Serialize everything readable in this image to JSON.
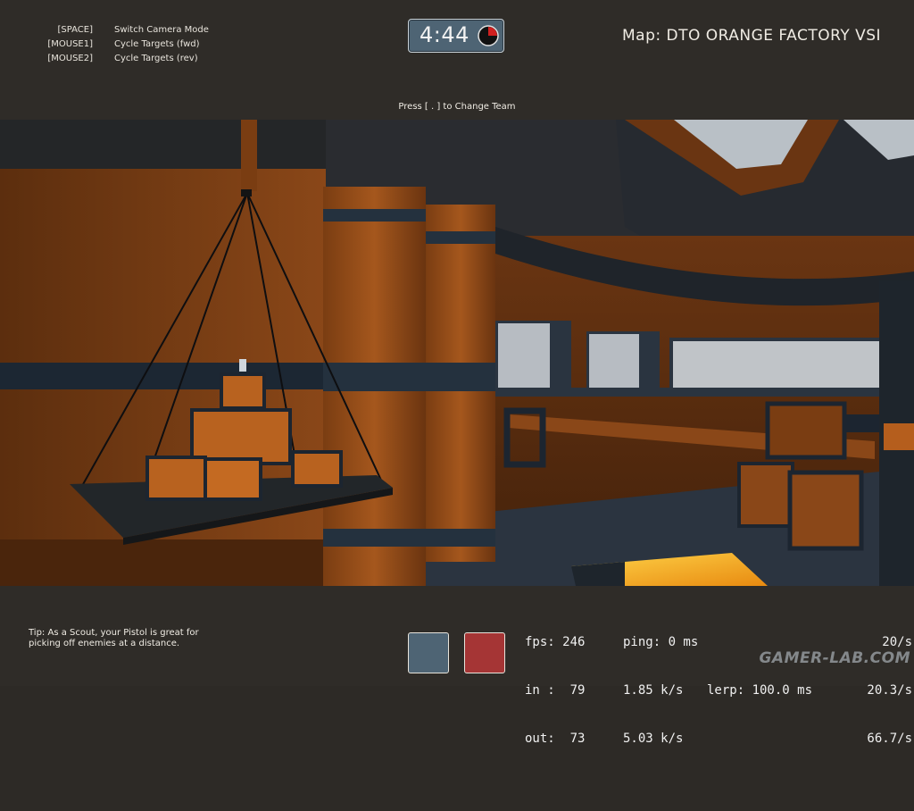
{
  "key_binds": [
    {
      "key": "[SPACE]",
      "action": "Switch Camera Mode"
    },
    {
      "key": "[MOUSE1]",
      "action": "Cycle Targets (fwd)"
    },
    {
      "key": "[MOUSE2]",
      "action": "Cycle Targets (rev)"
    }
  ],
  "round_timer": {
    "time": "4:44",
    "elapsed_fraction": 0.25
  },
  "map": {
    "label": "Map: DTO ORANGE FACTORY VSI"
  },
  "team_hint": "Press [ . ] to Change Team",
  "tip": "Tip: As a Scout, your Pistol is great for picking off enemies at a distance.",
  "team_buttons": {
    "blue_color": "#4e6474",
    "red_color": "#a53535"
  },
  "net_graph": {
    "fps": "fps: 246",
    "ping": "ping: 0 ms",
    "rate_top": "20/s",
    "in": "in :  79",
    "in_rate": "1.85 k/s",
    "lerp": "lerp: 100.0 ms",
    "rate_mid": "20.3/s",
    "out": "out:  73",
    "out_rate": "5.03 k/s",
    "rate_bot": "66.7/s"
  },
  "watermark": "GAMER-LAB.COM",
  "colors": {
    "hud_bar": "#2f2c28",
    "wall_orange": "#7a3f14",
    "trim_blue": "#24313e"
  }
}
